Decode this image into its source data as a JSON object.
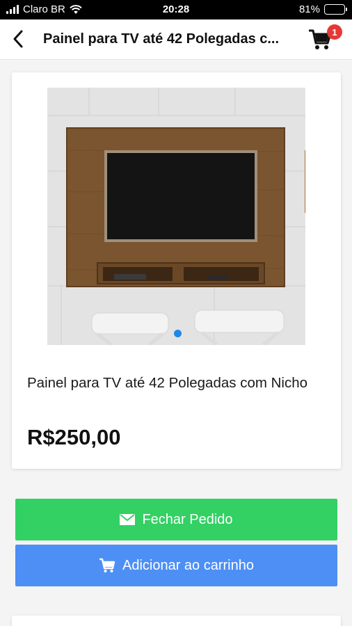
{
  "status_bar": {
    "carrier": "Claro BR",
    "time": "20:28",
    "battery_percent": "81%",
    "battery_level": 0.81
  },
  "header": {
    "title": "Painel para TV até 42 Polegadas c...",
    "back_icon": "chevron-left-icon",
    "cart_icon": "shopping-cart-icon",
    "cart_count": "1"
  },
  "product": {
    "name": "Painel para TV até 42 Polegadas com Nicho",
    "price": "R$250,00",
    "image_subject": "wooden TV panel with niche",
    "carousel_active_color": "#1e88e5"
  },
  "actions": {
    "checkout_label": "Fechar Pedido",
    "checkout_icon": "envelope-icon",
    "add_to_cart_label": "Adicionar ao carrinho",
    "add_to_cart_icon": "shopping-cart-icon"
  },
  "colors": {
    "checkout_button": "#33d063",
    "cart_button": "#4d8ff5",
    "badge": "#e53935"
  }
}
